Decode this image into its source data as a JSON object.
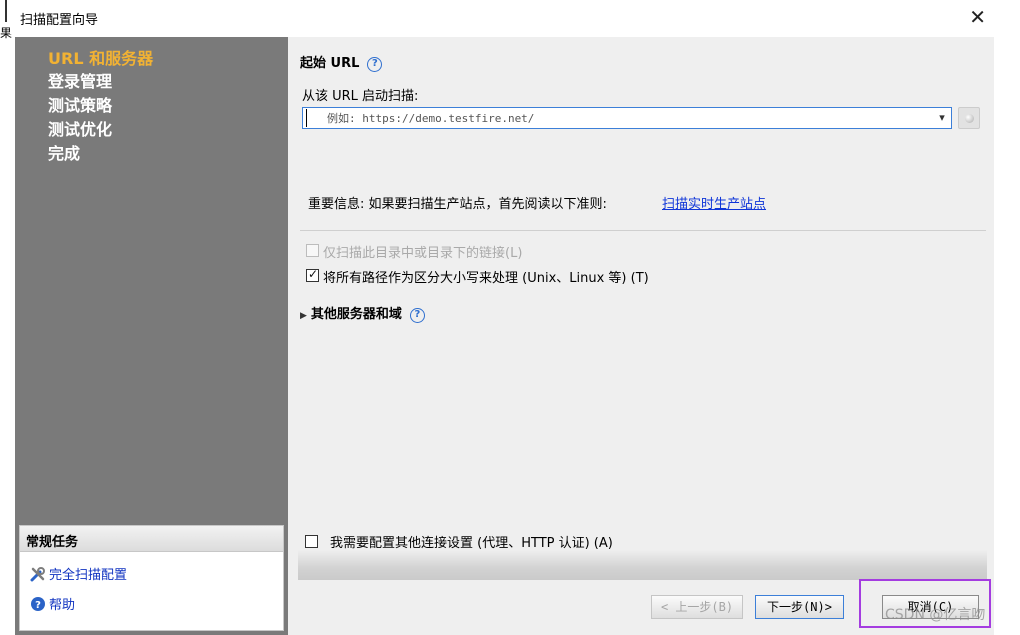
{
  "window": {
    "title": "扫描配置向导",
    "left_edge_char": "果"
  },
  "nav": {
    "items": [
      {
        "label": "URL 和服务器",
        "active": true
      },
      {
        "label": "登录管理",
        "active": false
      },
      {
        "label": "测试策略",
        "active": false
      },
      {
        "label": "测试优化",
        "active": false
      },
      {
        "label": "完成",
        "active": false
      }
    ]
  },
  "tasks": {
    "title": "常规任务",
    "items": [
      {
        "label": "完全扫描配置",
        "icon": "tools-icon"
      },
      {
        "label": "帮助",
        "icon": "help-icon"
      }
    ]
  },
  "main": {
    "start_url_label": "起始 URL",
    "scan_from_label": "从该 URL 启动扫描:",
    "url_input": {
      "value": "",
      "placeholder": "例如: https://demo.testfire.net/"
    },
    "important_info": "重要信息: 如果要扫描生产站点，首先阅读以下准则:",
    "production_link": "扫描实时生产站点",
    "option_dir_only": {
      "label": "仅扫描此目录中或目录下的链接(L)",
      "checked": false,
      "enabled": false
    },
    "option_case_sensitive": {
      "label": "将所有路径作为区分大小写来处理 (Unix、Linux 等) (T)",
      "checked": true,
      "enabled": true
    },
    "other_servers_label": "其他服务器和域",
    "connection_option": {
      "label": "我需要配置其他连接设置 (代理、HTTP 认证) (A)",
      "checked": false
    }
  },
  "buttons": {
    "back": "< 上一步(B)",
    "next": "下一步(N)>",
    "cancel": "取消(C)"
  },
  "watermark": "CSDN @亿言吻",
  "colors": {
    "sidebar_bg": "#7a7a7a",
    "nav_active": "#f2b233",
    "link": "#0f35d8",
    "highlight": "#a43ce0"
  }
}
